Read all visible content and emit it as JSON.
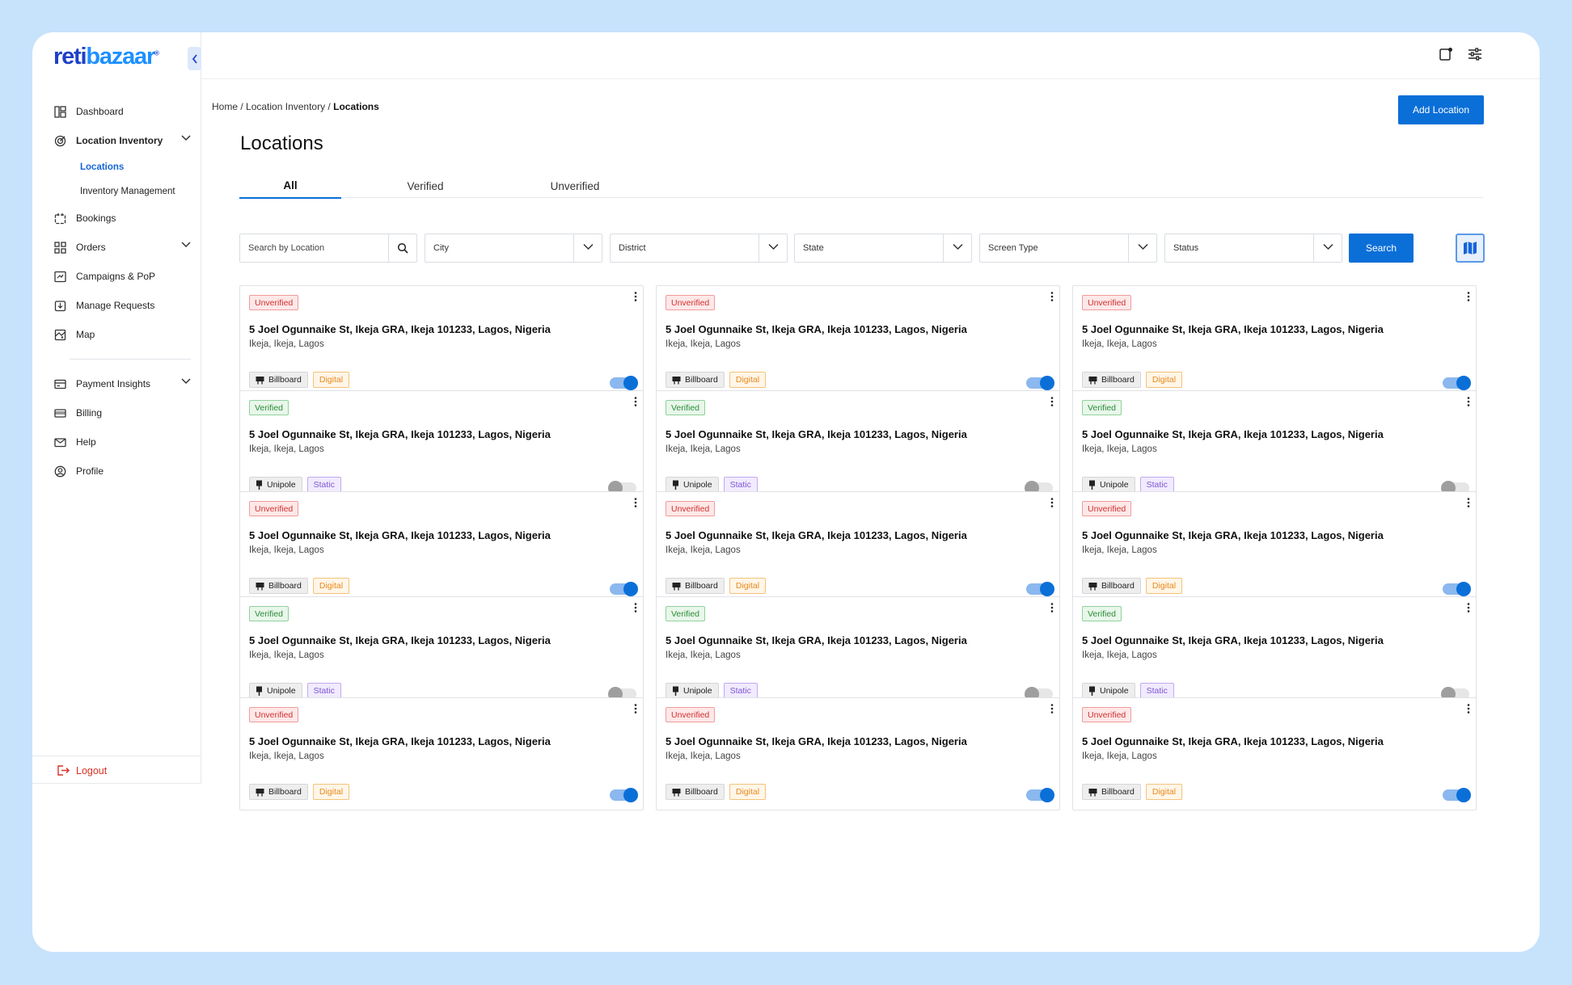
{
  "brand": {
    "logo_part1": "reti",
    "logo_part2": "bazaar",
    "trademark": "®"
  },
  "sidebar": {
    "items": [
      {
        "label": "Dashboard",
        "icon": "dashboard-icon"
      },
      {
        "label": "Location Inventory",
        "icon": "target-icon"
      },
      {
        "label": "Bookings",
        "icon": "calendar-icon"
      },
      {
        "label": "Orders",
        "icon": "grid-icon"
      },
      {
        "label": "Campaigns & PoP",
        "icon": "campaign-icon"
      },
      {
        "label": "Manage Requests",
        "icon": "request-icon"
      },
      {
        "label": "Map",
        "icon": "map-icon"
      },
      {
        "label": "Payment Insights",
        "icon": "payment-icon"
      },
      {
        "label": "Billing",
        "icon": "billing-icon"
      },
      {
        "label": "Help",
        "icon": "mail-icon"
      },
      {
        "label": "Profile",
        "icon": "profile-icon"
      }
    ],
    "sub_items": [
      {
        "label": "Locations"
      },
      {
        "label": "Inventory Management"
      }
    ],
    "logout_label": "Logout"
  },
  "breadcrumb": {
    "home": "Home",
    "sep1": " / ",
    "inventory": "Location Inventory",
    "sep2": " / ",
    "current": "Locations"
  },
  "header": {
    "add_button": "Add Location",
    "title": "Locations"
  },
  "tabs": [
    "All",
    "Verified",
    "Unverified"
  ],
  "filters": {
    "search_placeholder": "Search by Location",
    "city": "City",
    "district": "District",
    "state": "State",
    "screen_type": "Screen Type",
    "status": "Status",
    "search_button": "Search"
  },
  "cards": [
    {
      "status": "Unverified",
      "address": "5 Joel Ogunnaike St, Ikeja GRA, Ikeja 101233, Lagos, Nigeria",
      "area": "Ikeja, Ikeja, Lagos",
      "type": "Billboard",
      "format": "Digital",
      "active": true
    },
    {
      "status": "Unverified",
      "address": "5 Joel Ogunnaike St, Ikeja GRA, Ikeja 101233, Lagos, Nigeria",
      "area": "Ikeja, Ikeja, Lagos",
      "type": "Billboard",
      "format": "Digital",
      "active": true
    },
    {
      "status": "Unverified",
      "address": "5 Joel Ogunnaike St, Ikeja GRA, Ikeja 101233, Lagos, Nigeria",
      "area": "Ikeja, Ikeja, Lagos",
      "type": "Billboard",
      "format": "Digital",
      "active": true
    },
    {
      "status": "Verified",
      "address": "5 Joel Ogunnaike St, Ikeja GRA, Ikeja 101233, Lagos, Nigeria",
      "area": "Ikeja, Ikeja, Lagos",
      "type": "Unipole",
      "format": "Static",
      "active": false
    },
    {
      "status": "Verified",
      "address": "5 Joel Ogunnaike St, Ikeja GRA, Ikeja 101233, Lagos, Nigeria",
      "area": "Ikeja, Ikeja, Lagos",
      "type": "Unipole",
      "format": "Static",
      "active": false
    },
    {
      "status": "Verified",
      "address": "5 Joel Ogunnaike St, Ikeja GRA, Ikeja 101233, Lagos, Nigeria",
      "area": "Ikeja, Ikeja, Lagos",
      "type": "Unipole",
      "format": "Static",
      "active": false
    },
    {
      "status": "Unverified",
      "address": "5 Joel Ogunnaike St, Ikeja GRA, Ikeja 101233, Lagos, Nigeria",
      "area": "Ikeja, Ikeja, Lagos",
      "type": "Billboard",
      "format": "Digital",
      "active": true
    },
    {
      "status": "Unverified",
      "address": "5 Joel Ogunnaike St, Ikeja GRA, Ikeja 101233, Lagos, Nigeria",
      "area": "Ikeja, Ikeja, Lagos",
      "type": "Billboard",
      "format": "Digital",
      "active": true
    },
    {
      "status": "Unverified",
      "address": "5 Joel Ogunnaike St, Ikeja GRA, Ikeja 101233, Lagos, Nigeria",
      "area": "Ikeja, Ikeja, Lagos",
      "type": "Billboard",
      "format": "Digital",
      "active": true
    },
    {
      "status": "Verified",
      "address": "5 Joel Ogunnaike St, Ikeja GRA, Ikeja 101233, Lagos, Nigeria",
      "area": "Ikeja, Ikeja, Lagos",
      "type": "Unipole",
      "format": "Static",
      "active": false
    },
    {
      "status": "Verified",
      "address": "5 Joel Ogunnaike St, Ikeja GRA, Ikeja 101233, Lagos, Nigeria",
      "area": "Ikeja, Ikeja, Lagos",
      "type": "Unipole",
      "format": "Static",
      "active": false
    },
    {
      "status": "Verified",
      "address": "5 Joel Ogunnaike St, Ikeja GRA, Ikeja 101233, Lagos, Nigeria",
      "area": "Ikeja, Ikeja, Lagos",
      "type": "Unipole",
      "format": "Static",
      "active": false
    },
    {
      "status": "Unverified",
      "address": "5 Joel Ogunnaike St, Ikeja GRA, Ikeja 101233, Lagos, Nigeria",
      "area": "Ikeja, Ikeja, Lagos",
      "type": "Billboard",
      "format": "Digital",
      "active": true
    },
    {
      "status": "Unverified",
      "address": "5 Joel Ogunnaike St, Ikeja GRA, Ikeja 101233, Lagos, Nigeria",
      "area": "Ikeja, Ikeja, Lagos",
      "type": "Billboard",
      "format": "Digital",
      "active": true
    },
    {
      "status": "Unverified",
      "address": "5 Joel Ogunnaike St, Ikeja GRA, Ikeja 101233, Lagos, Nigeria",
      "area": "Ikeja, Ikeja, Lagos",
      "type": "Billboard",
      "format": "Digital",
      "active": true
    }
  ],
  "colors": {
    "accent": "#0b6fd8",
    "background": "#c7e2fb",
    "danger": "#d32f2f",
    "success": "#2e8b3a"
  }
}
